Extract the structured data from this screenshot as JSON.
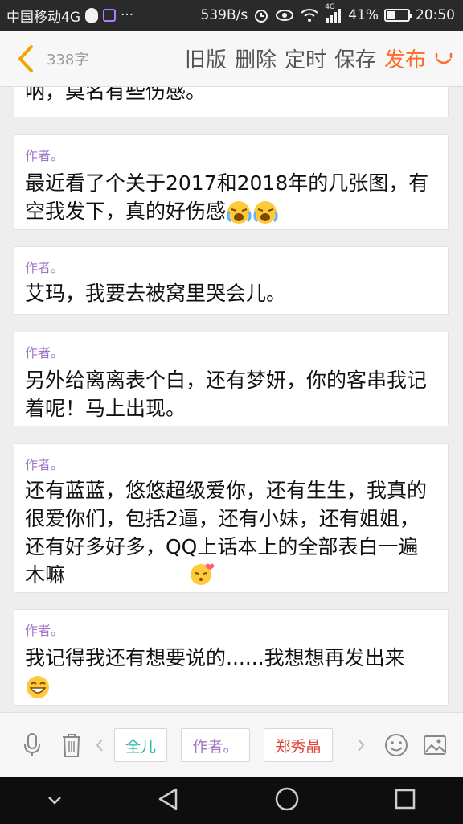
{
  "status_bar": {
    "carrier": "中国移动4G",
    "dots": "···",
    "speed": "539B/s",
    "network": "4G",
    "battery": "41%",
    "battery_level": 0.41,
    "time": "20:50"
  },
  "toolbar": {
    "word_count": "338字",
    "old_version": "旧版",
    "delete": "删除",
    "scheduled": "定时",
    "save": "保存",
    "publish": "发布"
  },
  "cards": [
    {
      "author": "",
      "text": "呐，莫名有些伤感。"
    },
    {
      "author": "作者。",
      "text": "最近看了个关于2017和2018年的几张图，有空我发下，真的好伤感"
    },
    {
      "author": "作者。",
      "text": "艾玛，我要去被窝里哭会儿。"
    },
    {
      "author": "作者。",
      "text": "另外给离离表个白，还有梦妍，你的客串我记着呢！马上出现。"
    },
    {
      "author": "作者。",
      "text": "还有蓝蓝，悠悠超级爱你，还有生生，我真的很爱你们，包括2逼，还有小妹，还有姐姐，还有好多好多，QQ上话本上的全部表白一遍木嘛"
    },
    {
      "author": "作者。",
      "text": "我记得我还有想要说的......我想想再发出来"
    }
  ],
  "bottom_bar": {
    "chips": [
      {
        "label": "全儿",
        "color": "#2bb5a8"
      },
      {
        "label": "作者。",
        "color": "#a274c6"
      },
      {
        "label": "郑秀晶",
        "color": "#e0453a"
      }
    ]
  },
  "colors": {
    "accent": "#ff6a2a",
    "author": "#a274c6"
  }
}
